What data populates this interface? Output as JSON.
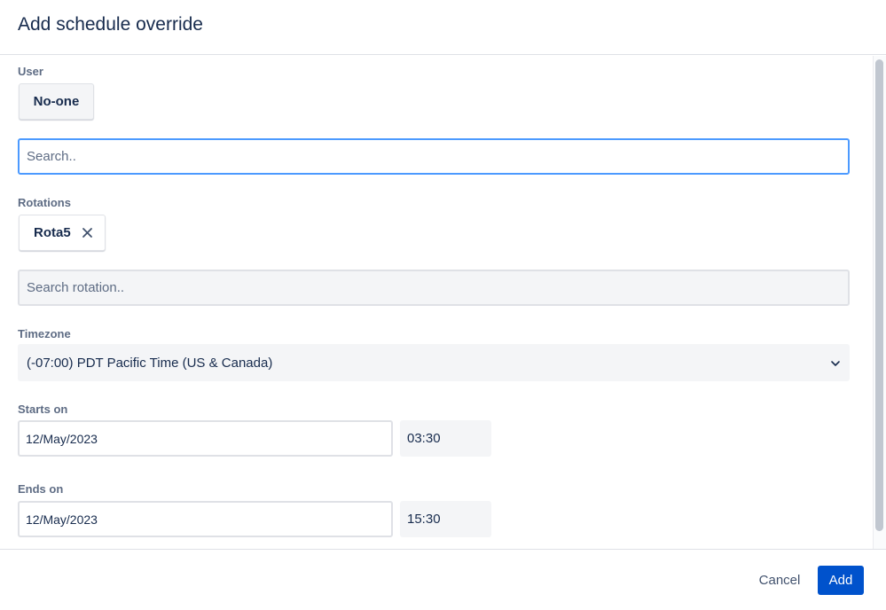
{
  "dialog": {
    "title": "Add schedule override"
  },
  "user": {
    "label": "User",
    "selected": "No-one",
    "search_placeholder": "Search.."
  },
  "rotations": {
    "label": "Rotations",
    "selected": "Rota5",
    "remove_icon": "close-icon",
    "search_placeholder": "Search rotation.."
  },
  "timezone": {
    "label": "Timezone",
    "value": "(-07:00) PDT Pacific Time (US & Canada)",
    "dropdown_icon": "chevron-down-icon"
  },
  "starts_on": {
    "label": "Starts on",
    "date": "12/May/2023",
    "time": "03:30"
  },
  "ends_on": {
    "label": "Ends on",
    "date": "12/May/2023",
    "time": "15:30"
  },
  "footer": {
    "cancel_label": "Cancel",
    "add_label": "Add"
  },
  "colors": {
    "primary": "#0052cc",
    "focus_border": "#4c9aff",
    "text": "#172b4d"
  }
}
